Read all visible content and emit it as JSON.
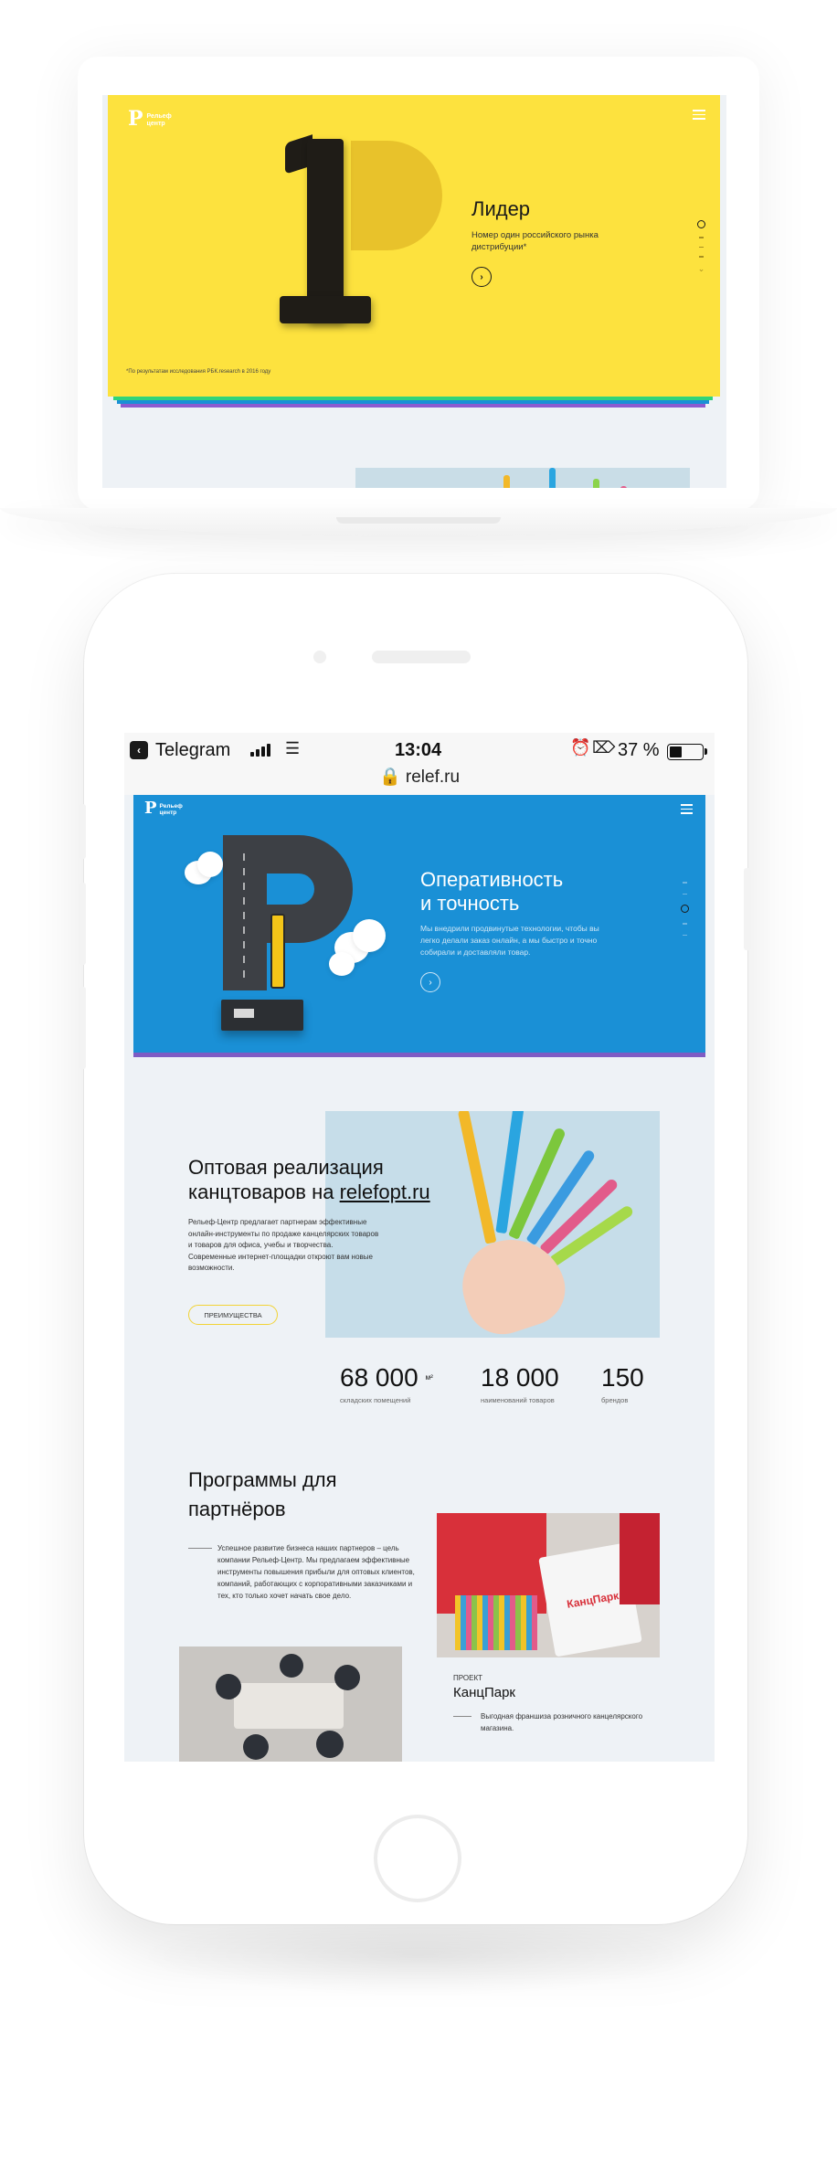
{
  "laptop": {
    "logo_mark": "Р",
    "logo_text_1": "Рельеф",
    "logo_text_2": "центр",
    "hero_title": "Лидер",
    "hero_text": "Номер один российского рынка дистрибуции*",
    "footnote": "*По результатам исследования РБК.research в 2016 году"
  },
  "phone": {
    "statusbar": {
      "app": "Telegram",
      "time": "13:04",
      "battery": "37 %",
      "battery_level": 0.37,
      "url": "relef.ru"
    },
    "logo_mark": "Р",
    "logo_text_1": "Рельеф",
    "logo_text_2": "центр",
    "hero": {
      "title_line1": "Оперативность",
      "title_line2": "и точность",
      "text": "Мы внедрили продвинутые технологии, чтобы вы легко делали заказ онлайн, а мы быстро и точно собирали и доставляли товар."
    },
    "wholesale": {
      "title_line1": "Оптовая реализация",
      "title_prefix": "канцтоваров на ",
      "title_link": "relefopt.ru",
      "text": "Рельеф-Центр предлагает партнерам эффективные онлайн-инструменты по продаже канцелярских товаров и товаров для офиса, учебы и творчества. Современные интернет-площадки откроют вам новые возможности.",
      "button": "ПРЕИМУЩЕСТВА"
    },
    "stats": [
      {
        "value": "68 000",
        "unit": "м²",
        "label": "складских помещений"
      },
      {
        "value": "18 000",
        "unit": "",
        "label": "наименований товаров"
      },
      {
        "value": "150",
        "unit": "",
        "label": "брендов"
      }
    ],
    "programs": {
      "title_line1": "Программы для",
      "title_line2": "партнёров",
      "text": "Успешное развитие бизнеса наших партнеров – цель компании Рельеф-Центр. Мы предлагаем эффективные инструменты повышения прибыли для оптовых клиентов, компаний, работающих с корпоративными заказчиками и тех, кто только хочет начать свое дело."
    },
    "project": {
      "label": "ПРОЕКТ",
      "name": "КанцПарк",
      "text": "Выгодная франшиза розничного канцелярского магазина.",
      "image_logo": "КанцПарк"
    }
  }
}
